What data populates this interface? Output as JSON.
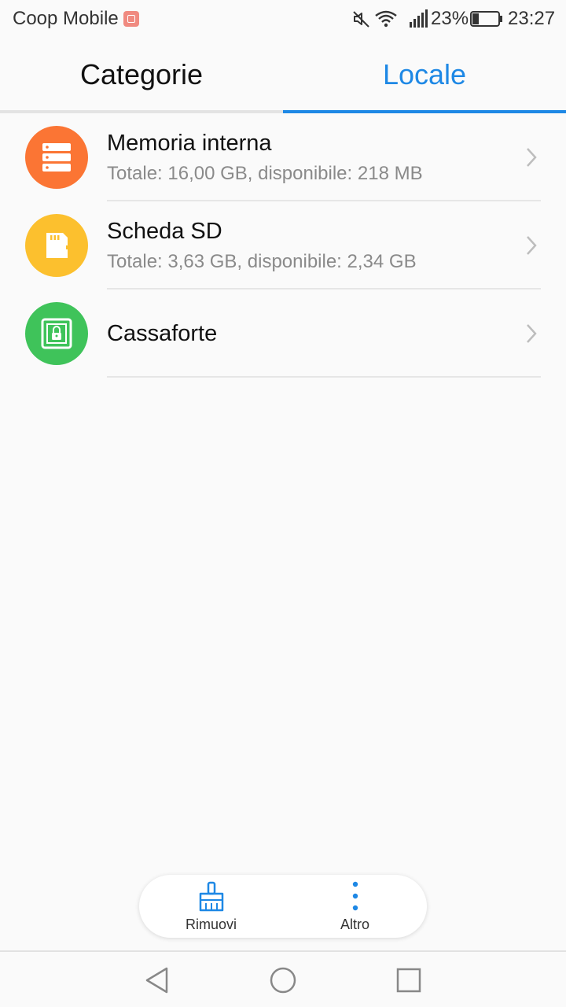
{
  "status_bar": {
    "carrier": "Coop Mobile",
    "battery": "23%",
    "time": "23:27",
    "icons": [
      "carrier-badge-icon",
      "mute-icon",
      "wifi-icon",
      "signal-icon",
      "battery-icon"
    ]
  },
  "tabs": [
    {
      "label": "Categorie",
      "selected": false
    },
    {
      "label": "Locale",
      "selected": true
    }
  ],
  "storage": [
    {
      "title": "Memoria interna",
      "subtitle": "Totale: 16,00 GB, disponibile: 218 MB",
      "icon": "server-icon",
      "color": "#fb7534"
    },
    {
      "title": "Scheda SD",
      "subtitle": "Totale: 3,63 GB, disponibile: 2,34 GB",
      "icon": "sd-card-icon",
      "color": "#fcc02e"
    },
    {
      "title": "Cassaforte",
      "subtitle": "",
      "icon": "safe-icon",
      "color": "#3fc35a"
    }
  ],
  "actions": [
    {
      "label": "Rimuovi",
      "icon": "broom-icon"
    },
    {
      "label": "Altro",
      "icon": "more-vertical-icon"
    }
  ],
  "colors": {
    "accent": "#1e88e5",
    "background": "#fafafa"
  }
}
